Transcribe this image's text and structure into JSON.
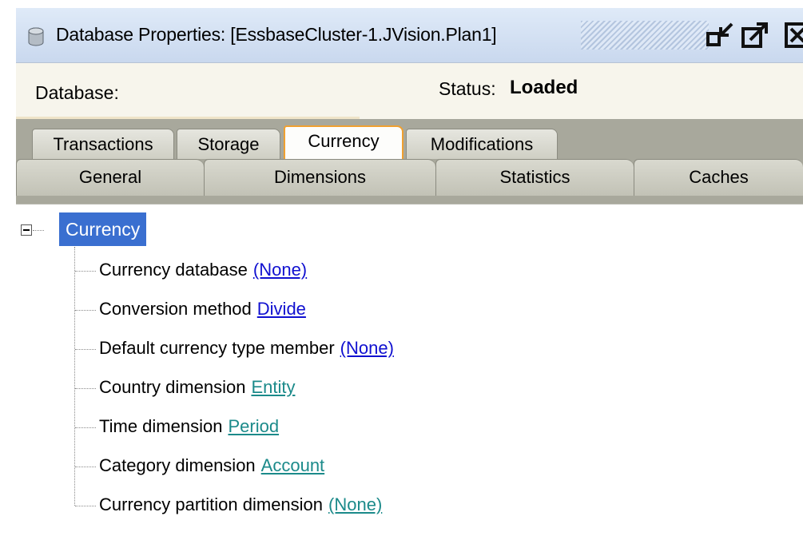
{
  "window": {
    "title": "Database Properties: [EssbaseCluster-1.JVision.Plan1]",
    "icons": [
      "database-icon",
      "minimize-icon",
      "maximize-icon",
      "close-icon"
    ]
  },
  "info": {
    "database_label": "Database:",
    "status_label": "Status:",
    "status_value": "Loaded"
  },
  "tabs": {
    "row1": [
      "Transactions",
      "Storage",
      "Currency",
      "Modifications"
    ],
    "row2": [
      "General",
      "Dimensions",
      "Statistics",
      "Caches"
    ],
    "active": "Currency"
  },
  "tree": {
    "root": "Currency",
    "items": [
      {
        "label": "Currency database",
        "value": "(None)",
        "value_color": "#1010d0"
      },
      {
        "label": "Conversion method",
        "value": "Divide",
        "value_color": "#1010d0"
      },
      {
        "label": "Default currency type member",
        "value": "(None)",
        "value_color": "#1010d0"
      },
      {
        "label": "Country dimension",
        "value": "Entity",
        "value_color": "#1b8a8a"
      },
      {
        "label": "Time dimension",
        "value": "Period",
        "value_color": "#1b8a8a"
      },
      {
        "label": "Category dimension",
        "value": "Account",
        "value_color": "#1b8a8a"
      },
      {
        "label": "Currency partition dimension",
        "value": "(None)",
        "value_color": "#1b8a8a"
      }
    ]
  },
  "colors": {
    "selection": "#3a6fd0",
    "active_tab_border": "#f0a030",
    "tab_strip": "#a8a89c"
  }
}
